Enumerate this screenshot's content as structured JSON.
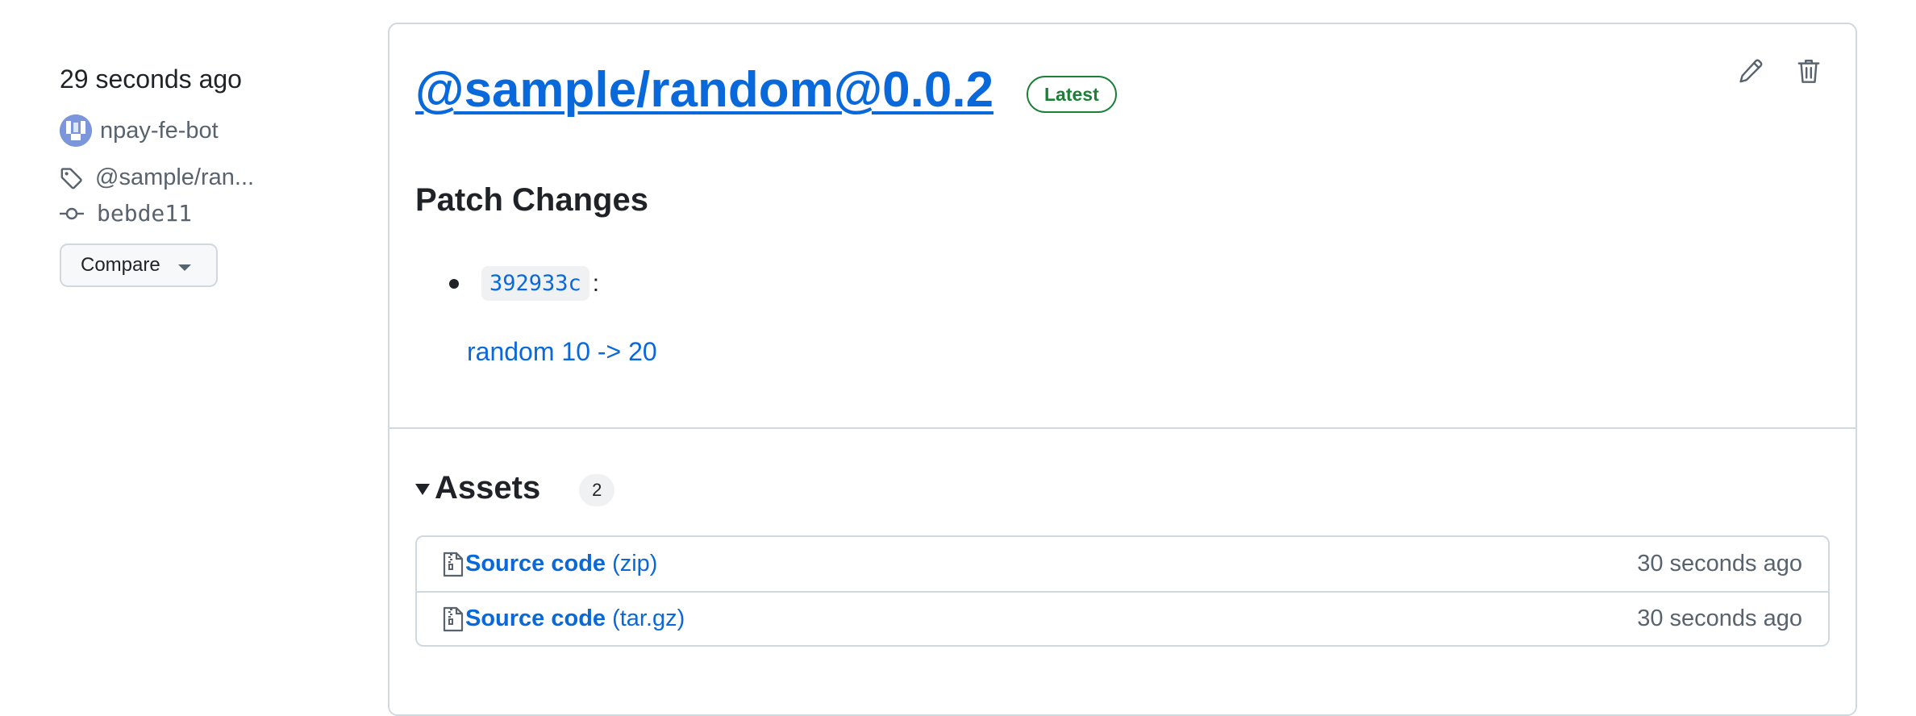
{
  "meta": {
    "published": "29 seconds ago",
    "author": "npay-fe-bot",
    "tag": "@sample/ran...",
    "commit": "bebde11",
    "compare_label": "Compare"
  },
  "release": {
    "title": "@sample/random@0.0.2",
    "badge": "Latest",
    "section_heading": "Patch Changes",
    "changes": [
      {
        "sha": "392933c",
        "separator": ":",
        "description": "random 10 -> 20"
      }
    ]
  },
  "assets": {
    "title": "Assets",
    "count": "2",
    "items": [
      {
        "name": "Source code",
        "type": "(zip)",
        "time": "30 seconds ago"
      },
      {
        "name": "Source code",
        "type": "(tar.gz)",
        "time": "30 seconds ago"
      }
    ]
  },
  "colors": {
    "link": "#0969da",
    "latest_badge": "#1a7f37",
    "muted_text": "#59636e",
    "border": "#d1d9e0"
  }
}
